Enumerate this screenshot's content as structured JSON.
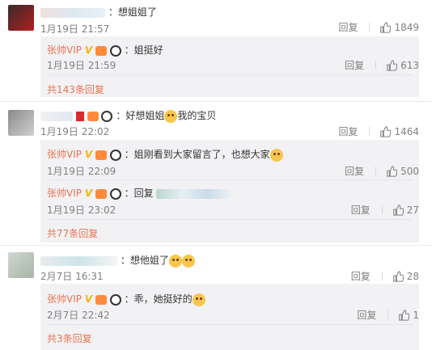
{
  "colors": {
    "accent": "#eb7350",
    "vip_badge": "#f8b500",
    "reply_bg": "#f2f2f5",
    "text_muted": "#808080"
  },
  "reply_label": "回复",
  "comments": [
    {
      "text": "：想姐姐了",
      "time": "1月19日 21:57",
      "likes": "1849",
      "replies": [
        {
          "author": "张帅VIP",
          "text": "：姐挺好",
          "time": "1月19日 21:59",
          "likes": "613"
        }
      ],
      "more": "共143条回复"
    },
    {
      "text": "：好想姐姐",
      "text_tail": "我的宝贝",
      "time": "1月19日 22:02",
      "likes": "1464",
      "replies": [
        {
          "author": "张帅VIP",
          "text": "：姐刚看到大家留言了，也想大家",
          "time": "1月19日 22:09",
          "likes": "500"
        },
        {
          "author": "张帅VIP",
          "text": "：回复",
          "time": "1月19日 23:02",
          "likes": "27"
        }
      ],
      "more": "共77条回复"
    },
    {
      "text": "：想他姐了",
      "time": "2月7日 16:31",
      "likes": "28",
      "replies": [
        {
          "author": "张帅VIP",
          "text": "：乖，她挺好的",
          "time": "2月7日 22:42",
          "likes": "1"
        }
      ],
      "more": "共3条回复"
    }
  ]
}
